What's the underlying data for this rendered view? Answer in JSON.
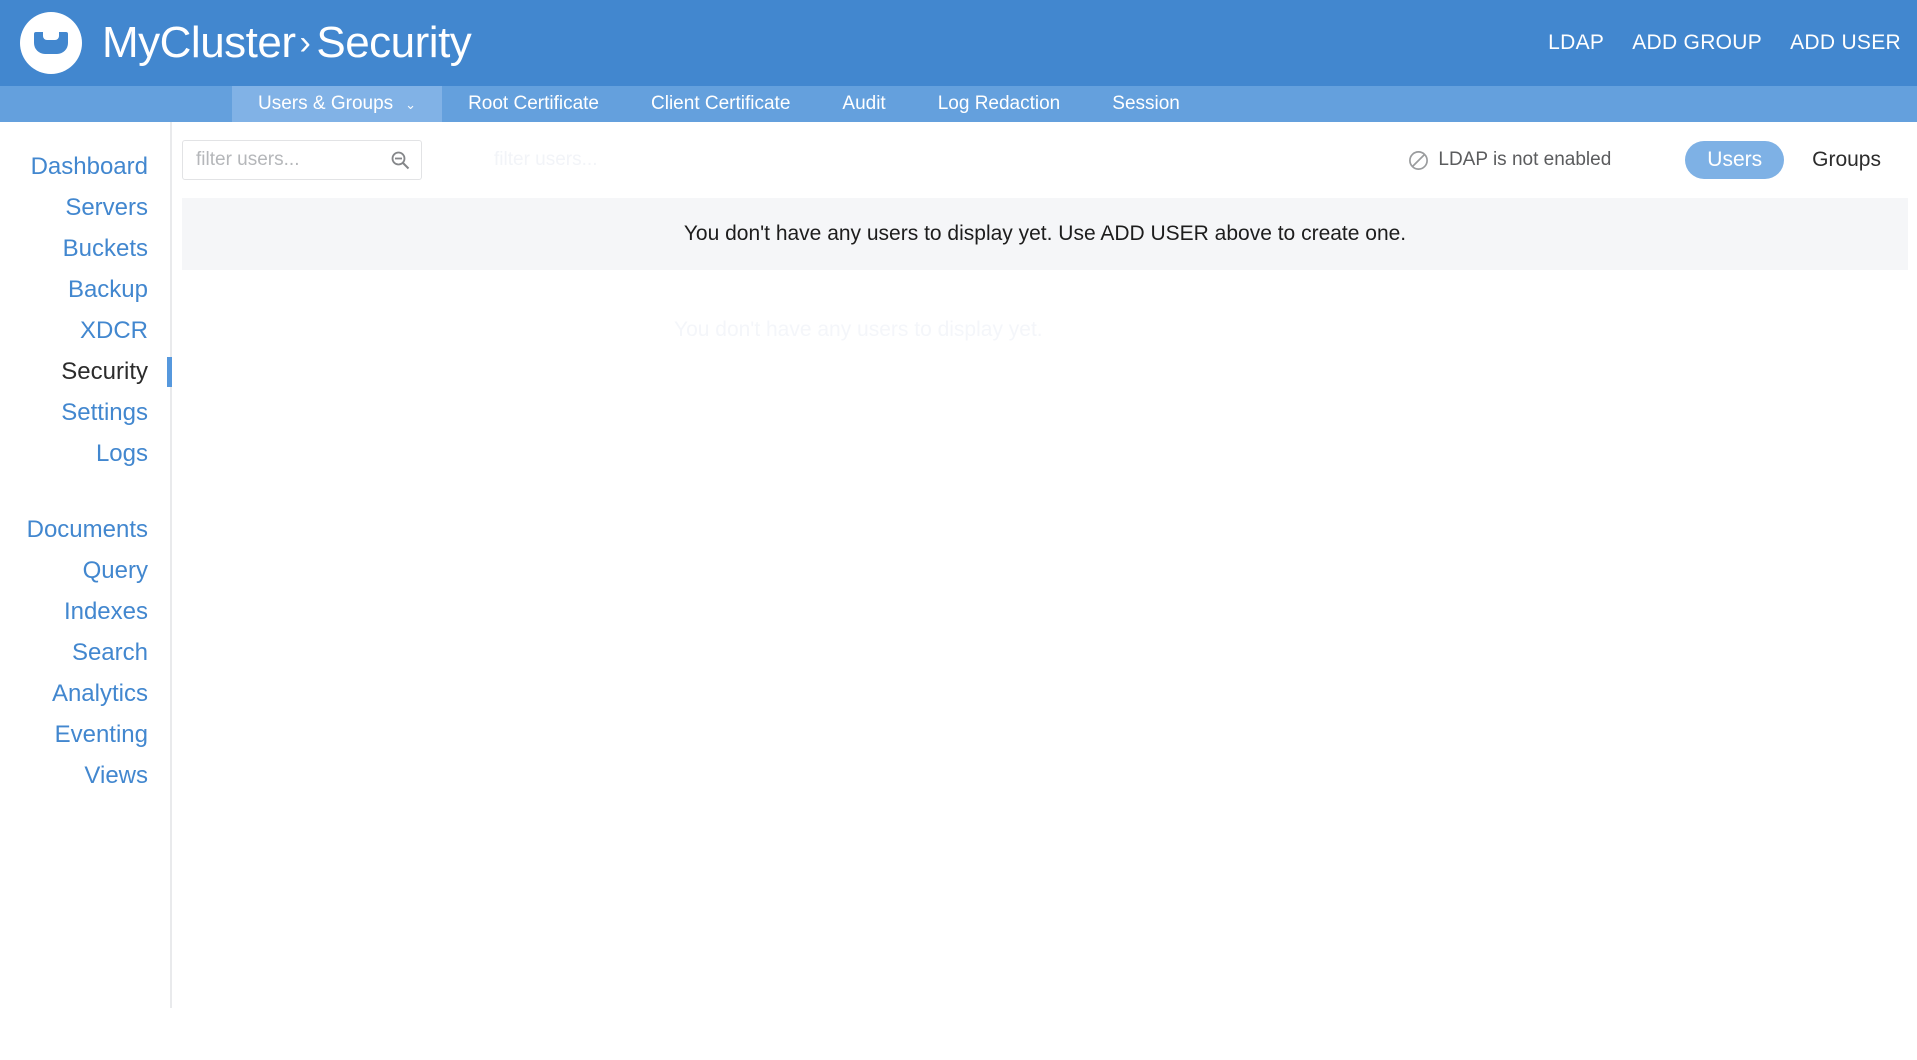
{
  "header": {
    "logo_icon": "couchbase-logo-icon",
    "cluster_name": "MyCluster",
    "separator": "›",
    "section": "Security",
    "actions": [
      {
        "label": "LDAP",
        "name": "ldap-button"
      },
      {
        "label": "ADD GROUP",
        "name": "add-group-button"
      },
      {
        "label": "ADD USER",
        "name": "add-user-button"
      }
    ]
  },
  "tabs": [
    {
      "label": "Users & Groups",
      "active": true,
      "caret": "⌄"
    },
    {
      "label": "Root Certificate",
      "active": false
    },
    {
      "label": "Client Certificate",
      "active": false
    },
    {
      "label": "Audit",
      "active": false
    },
    {
      "label": "Log Redaction",
      "active": false
    },
    {
      "label": "Session",
      "active": false
    }
  ],
  "sidebar": {
    "group_one": [
      {
        "label": "Dashboard",
        "active": false
      },
      {
        "label": "Servers",
        "active": false
      },
      {
        "label": "Buckets",
        "active": false
      },
      {
        "label": "Backup",
        "active": false
      },
      {
        "label": "XDCR",
        "active": false
      },
      {
        "label": "Security",
        "active": true
      },
      {
        "label": "Settings",
        "active": false
      },
      {
        "label": "Logs",
        "active": false
      }
    ],
    "group_two": [
      {
        "label": "Documents",
        "active": false
      },
      {
        "label": "Query",
        "active": false
      },
      {
        "label": "Indexes",
        "active": false
      },
      {
        "label": "Search",
        "active": false
      },
      {
        "label": "Analytics",
        "active": false
      },
      {
        "label": "Eventing",
        "active": false
      },
      {
        "label": "Views",
        "active": false
      }
    ]
  },
  "toolbar": {
    "filter_placeholder": "filter users...",
    "filter_value": "",
    "search_icon": "search-icon",
    "ghost_label": "filter users...",
    "ldap_status_icon": "ban-icon",
    "ldap_status_text": "LDAP is not enabled",
    "toggle": [
      {
        "label": "Users",
        "active": true
      },
      {
        "label": "Groups",
        "active": false
      }
    ]
  },
  "main": {
    "empty_message": "You don't have any users to display yet. Use ADD USER above to create one.",
    "watermark": "You don't have any users to display yet."
  },
  "colors": {
    "header_blue": "#4287cf",
    "tabbar_blue": "#64a0dd",
    "tab_active_blue": "#81b2e6",
    "link_blue": "#4287cf",
    "toggle_active": "#7eb1e5",
    "panel_gray": "#f5f6f8"
  }
}
